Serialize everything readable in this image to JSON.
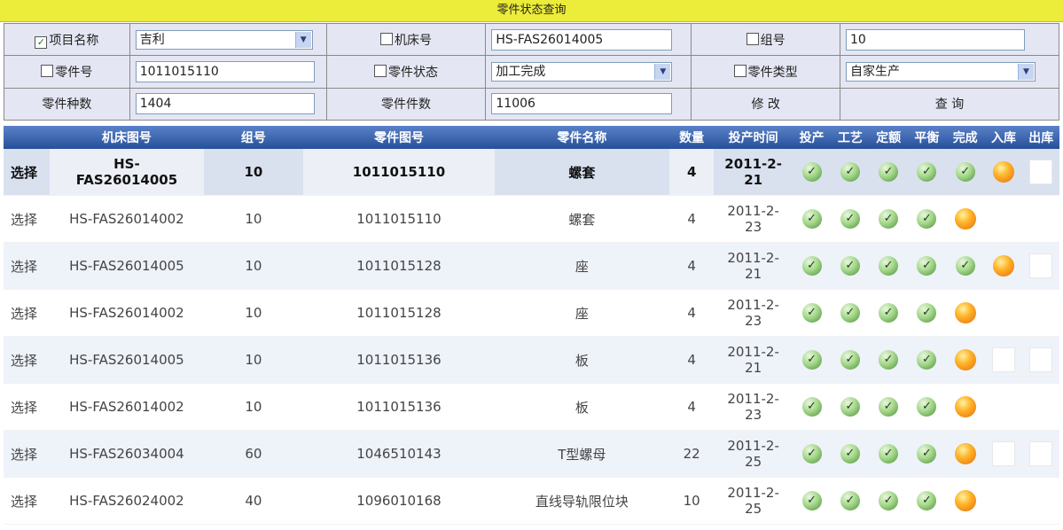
{
  "title": "零件状态查询",
  "filter": {
    "project_label": "项目名称",
    "project_value": "吉利",
    "machine_label": "机床号",
    "machine_value": "HS-FAS26014005",
    "group_label": "组号",
    "group_value": "10",
    "part_no_label": "零件号",
    "part_no_value": "1011015110",
    "part_status_label": "零件状态",
    "part_status_value": "加工完成",
    "part_type_label": "零件类型",
    "part_type_value": "自家生产",
    "kinds_label": "零件种数",
    "kinds_value": "1404",
    "count_label": "零件件数",
    "count_value": "11006",
    "modify_label": "修 改",
    "query_label": "查 询"
  },
  "grid": {
    "headers": [
      "机床图号",
      "组号",
      "零件图号",
      "零件名称",
      "数量",
      "投产时间",
      "投产",
      "工艺",
      "定额",
      "平衡",
      "完成",
      "入库",
      "出库"
    ],
    "rows": [
      {
        "select": "选择",
        "machine": "HS-\nFAS26014005",
        "group": "10",
        "part_no": "1011015110",
        "name": "螺套",
        "qty": "4",
        "date": "2011-2-\n21",
        "status": [
          "ok",
          "ok",
          "ok",
          "ok",
          "ok",
          "orb",
          "empty"
        ]
      },
      {
        "select": "选择",
        "machine": "HS-FAS26014002",
        "group": "10",
        "part_no": "1011015110",
        "name": "螺套",
        "qty": "4",
        "date": "2011-2-\n23",
        "status": [
          "ok",
          "ok",
          "ok",
          "ok",
          "orb",
          "none",
          "none"
        ]
      },
      {
        "select": "选择",
        "machine": "HS-FAS26014005",
        "group": "10",
        "part_no": "1011015128",
        "name": "座",
        "qty": "4",
        "date": "2011-2-\n21",
        "status": [
          "ok",
          "ok",
          "ok",
          "ok",
          "ok",
          "orb",
          "empty"
        ]
      },
      {
        "select": "选择",
        "machine": "HS-FAS26014002",
        "group": "10",
        "part_no": "1011015128",
        "name": "座",
        "qty": "4",
        "date": "2011-2-\n23",
        "status": [
          "ok",
          "ok",
          "ok",
          "ok",
          "orb",
          "none",
          "none"
        ]
      },
      {
        "select": "选择",
        "machine": "HS-FAS26014005",
        "group": "10",
        "part_no": "1011015136",
        "name": "板",
        "qty": "4",
        "date": "2011-2-\n21",
        "status": [
          "ok",
          "ok",
          "ok",
          "ok",
          "orb",
          "empty",
          "empty"
        ]
      },
      {
        "select": "选择",
        "machine": "HS-FAS26014002",
        "group": "10",
        "part_no": "1011015136",
        "name": "板",
        "qty": "4",
        "date": "2011-2-\n23",
        "status": [
          "ok",
          "ok",
          "ok",
          "ok",
          "orb",
          "none",
          "none"
        ]
      },
      {
        "select": "选择",
        "machine": "HS-FAS26034004",
        "group": "60",
        "part_no": "1046510143",
        "name": "T型螺母",
        "qty": "22",
        "date": "2011-2-\n25",
        "status": [
          "ok",
          "ok",
          "ok",
          "ok",
          "orb",
          "empty",
          "empty"
        ]
      },
      {
        "select": "选择",
        "machine": "HS-FAS26024002",
        "group": "40",
        "part_no": "1096010168",
        "name": "直线导轨限位块",
        "qty": "10",
        "date": "2011-2-\n25",
        "status": [
          "ok",
          "ok",
          "ok",
          "ok",
          "orb",
          "none",
          "none"
        ]
      }
    ]
  }
}
